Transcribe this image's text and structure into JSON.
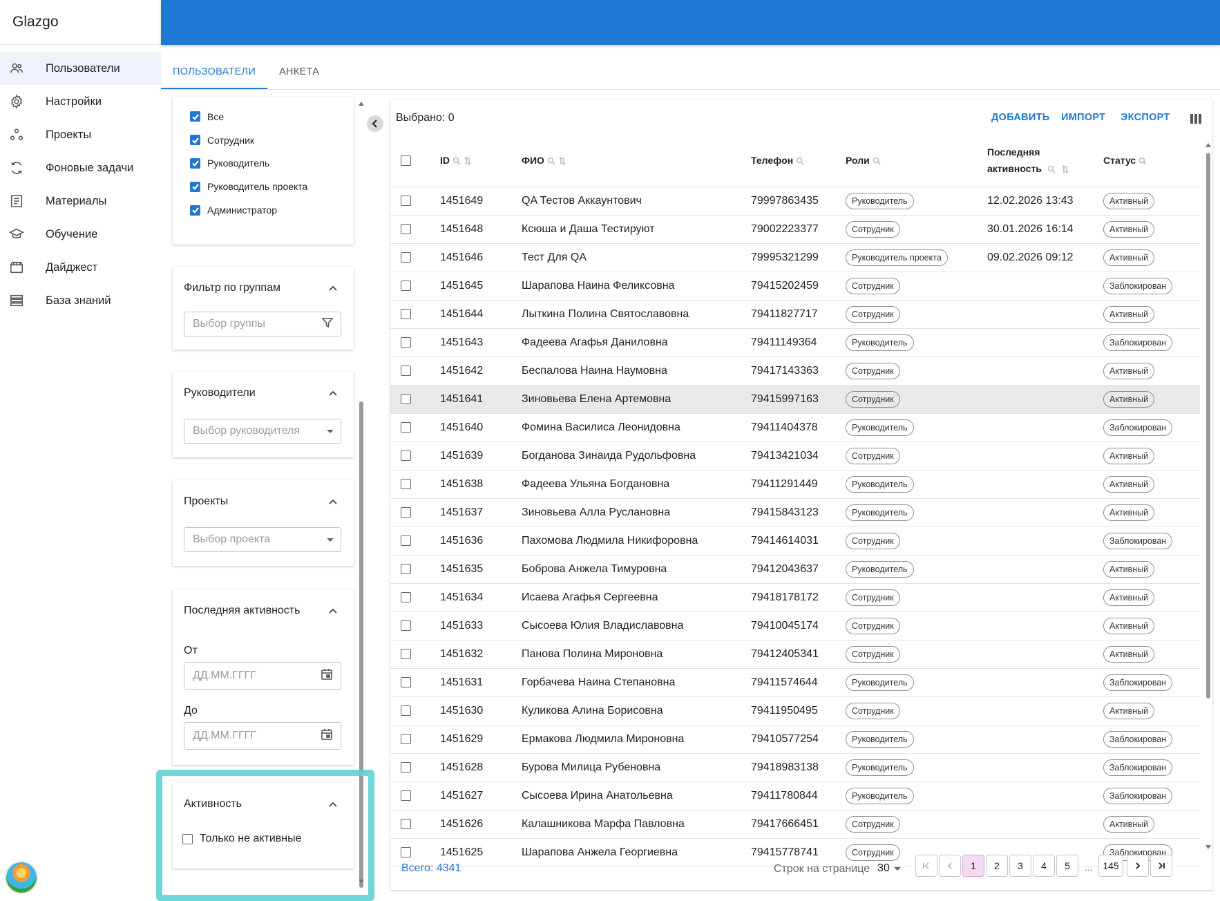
{
  "app": {
    "brand": "Glazgo"
  },
  "sidebar": {
    "items": [
      {
        "label": "Пользователи",
        "icon": "users-icon",
        "active": true
      },
      {
        "label": "Настройки",
        "icon": "gear-icon"
      },
      {
        "label": "Проекты",
        "icon": "projects-icon"
      },
      {
        "label": "Фоновые задачи",
        "icon": "sync-icon"
      },
      {
        "label": "Материалы",
        "icon": "document-icon"
      },
      {
        "label": "Обучение",
        "icon": "graduation-cap-icon"
      },
      {
        "label": "Дайджест",
        "icon": "clapperboard-icon"
      },
      {
        "label": "База знаний",
        "icon": "stack-icon"
      }
    ]
  },
  "tabs": [
    {
      "label": "ПОЛЬЗОВАТЕЛИ",
      "active": true
    },
    {
      "label": "АНКЕТА"
    }
  ],
  "filters": {
    "roles": [
      "Все",
      "Сотрудник",
      "Руководитель",
      "Руководитель проекта",
      "Администратор"
    ],
    "groups": {
      "title": "Фильтр по группам",
      "placeholder": "Выбор группы"
    },
    "managers": {
      "title": "Руководители",
      "placeholder": "Выбор руководителя"
    },
    "projects": {
      "title": "Проекты",
      "placeholder": "Выбор проекта"
    },
    "last_activity": {
      "title": "Последняя активность",
      "from_label": "От",
      "to_label": "До",
      "date_placeholder": "ДД.ММ.ГГГГ"
    },
    "activity": {
      "title": "Активность",
      "only_inactive": "Только не активные"
    }
  },
  "toolbar": {
    "selected": "Выбрано: 0",
    "add": "ДОБАВИТЬ",
    "import": "ИМПОРТ",
    "export": "ЭКСПОРТ"
  },
  "table": {
    "headers": {
      "id": "ID",
      "fio": "ФИО",
      "phone": "Телефон",
      "roles": "Роли",
      "last1": "Последняя",
      "last2": "активность",
      "status": "Статус"
    },
    "rows": [
      {
        "id": "1451649",
        "fio": "QA Тестов Аккаунтович",
        "phone": "79997863435",
        "role": "Руководитель",
        "last": "12.02.2026 13:43",
        "status": "Активный"
      },
      {
        "id": "1451648",
        "fio": "Ксюша и Даша Тестируют",
        "phone": "79002223377",
        "role": "Сотрудник",
        "last": "30.01.2026 16:14",
        "status": "Активный"
      },
      {
        "id": "1451646",
        "fio": "Тест Для QA",
        "phone": "79995321299",
        "role": "Руководитель проекта",
        "last": "09.02.2026 09:12",
        "status": "Активный"
      },
      {
        "id": "1451645",
        "fio": "Шарапова Наина Феликсовна",
        "phone": "79415202459",
        "role": "Сотрудник",
        "last": "",
        "status": "Заблокирован"
      },
      {
        "id": "1451644",
        "fio": "Лыткина Полина Святославовна",
        "phone": "79411827717",
        "role": "Сотрудник",
        "last": "",
        "status": "Активный"
      },
      {
        "id": "1451643",
        "fio": "Фадеева Агафья Даниловна",
        "phone": "79411149364",
        "role": "Руководитель",
        "last": "",
        "status": "Заблокирован"
      },
      {
        "id": "1451642",
        "fio": "Беспалова Наина Наумовна",
        "phone": "79417143363",
        "role": "Сотрудник",
        "last": "",
        "status": "Активный"
      },
      {
        "id": "1451641",
        "fio": "Зиновьева Елена Артемовна",
        "phone": "79415997163",
        "role": "Сотрудник",
        "last": "",
        "status": "Активный",
        "highlight": true
      },
      {
        "id": "1451640",
        "fio": "Фомина Василиса Леонидовна",
        "phone": "79411404378",
        "role": "Руководитель",
        "last": "",
        "status": "Заблокирован"
      },
      {
        "id": "1451639",
        "fio": "Богданова Зинаида Рудольфовна",
        "phone": "79413421034",
        "role": "Сотрудник",
        "last": "",
        "status": "Активный"
      },
      {
        "id": "1451638",
        "fio": "Фадеева Ульяна Богдановна",
        "phone": "79411291449",
        "role": "Руководитель",
        "last": "",
        "status": "Активный"
      },
      {
        "id": "1451637",
        "fio": "Зиновьева Алла Руслановна",
        "phone": "79415843123",
        "role": "Руководитель",
        "last": "",
        "status": "Активный"
      },
      {
        "id": "1451636",
        "fio": "Пахомова Людмила Никифоровна",
        "phone": "79414614031",
        "role": "Сотрудник",
        "last": "",
        "status": "Заблокирован"
      },
      {
        "id": "1451635",
        "fio": "Боброва Анжела Тимуровна",
        "phone": "79412043637",
        "role": "Руководитель",
        "last": "",
        "status": "Активный"
      },
      {
        "id": "1451634",
        "fio": "Исаева Агафья Сергеевна",
        "phone": "79418178172",
        "role": "Сотрудник",
        "last": "",
        "status": "Активный"
      },
      {
        "id": "1451633",
        "fio": "Сысоева Юлия Владиславовна",
        "phone": "79410045174",
        "role": "Сотрудник",
        "last": "",
        "status": "Активный"
      },
      {
        "id": "1451632",
        "fio": "Панова Полина Мироновна",
        "phone": "79412405341",
        "role": "Сотрудник",
        "last": "",
        "status": "Активный"
      },
      {
        "id": "1451631",
        "fio": "Горбачева Наина Степановна",
        "phone": "79411574644",
        "role": "Руководитель",
        "last": "",
        "status": "Заблокирован"
      },
      {
        "id": "1451630",
        "fio": "Куликова Алина Борисовна",
        "phone": "79411950495",
        "role": "Сотрудник",
        "last": "",
        "status": "Активный"
      },
      {
        "id": "1451629",
        "fio": "Ермакова Людмила Мироновна",
        "phone": "79410577254",
        "role": "Руководитель",
        "last": "",
        "status": "Заблокирован"
      },
      {
        "id": "1451628",
        "fio": "Бурова Милица Рубеновна",
        "phone": "79418983138",
        "role": "Руководитель",
        "last": "",
        "status": "Заблокирован"
      },
      {
        "id": "1451627",
        "fio": "Сысоева Ирина Анатольевна",
        "phone": "79411780844",
        "role": "Руководитель",
        "last": "",
        "status": "Заблокирован"
      },
      {
        "id": "1451626",
        "fio": "Калашникова Марфа Павловна",
        "phone": "79417666451",
        "role": "Сотрудник",
        "last": "",
        "status": "Активный"
      },
      {
        "id": "1451625",
        "fio": "Шарапова Анжела Георгиевна",
        "phone": "79415778741",
        "role": "Сотрудник",
        "last": "",
        "status": "Заблокирован"
      }
    ]
  },
  "footer": {
    "total": "Всего: 4341",
    "rows_per_page_label": "Строк на странице",
    "rows_per_page_value": "30",
    "pages": [
      "1",
      "2",
      "3",
      "4",
      "5"
    ],
    "ellipsis": "...",
    "last_page": "145",
    "current_page": "1"
  }
}
